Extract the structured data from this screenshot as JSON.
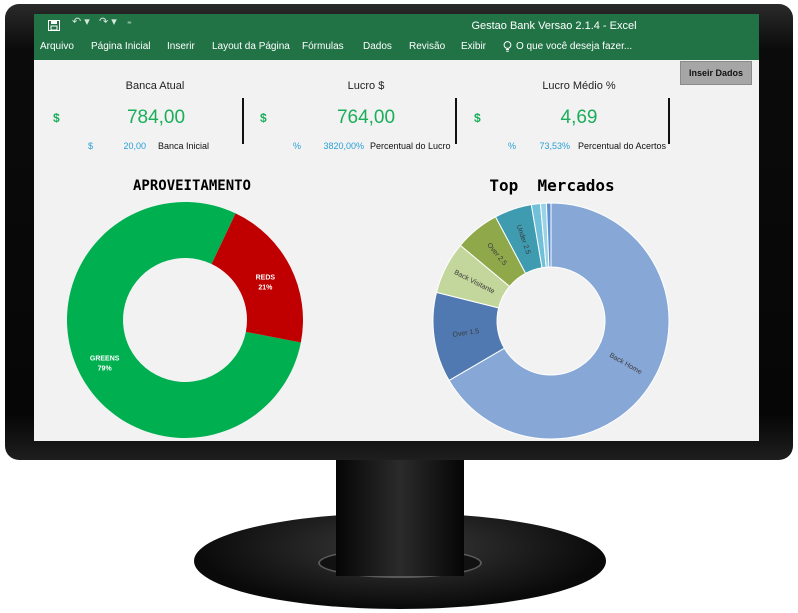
{
  "window": {
    "title": "Gestao Bank Versao 2.1.4 - Excel",
    "quick_access": [
      "save-icon",
      "undo-icon",
      "redo-icon",
      "customize-icon"
    ]
  },
  "ribbon": {
    "tabs": [
      "Arquivo",
      "Página Inicial",
      "Inserir",
      "Layout da Página",
      "Fórmulas",
      "Dados",
      "Revisão",
      "Exibir"
    ],
    "tell_me": "O que você deseja fazer...",
    "tell_me_icon": "lightbulb-icon",
    "accent_color": "#217346"
  },
  "dashboard": {
    "button_label": "Inseir Dados",
    "kpis": [
      {
        "title": "Banca Atual",
        "currency": "$",
        "value": "784,00",
        "sub_symbol": "$",
        "sub_value": "20,00",
        "sub_label": "Banca Inicial"
      },
      {
        "title": "Lucro $",
        "currency": "$",
        "value": "764,00",
        "sub_symbol": "%",
        "sub_value": "3820,00%",
        "sub_label": "Percentual do Lucro"
      },
      {
        "title": "Lucro Médio %",
        "currency": "$",
        "value": "4,69",
        "sub_symbol": "%",
        "sub_value": "73,53%",
        "sub_label": "Percentual do Acertos"
      }
    ]
  },
  "chart_data": [
    {
      "type": "pie",
      "title": "APROVEITAMENTO",
      "donut": true,
      "slices": [
        {
          "label": "GREENS",
          "value": 79,
          "display": "79%",
          "color": "#00b050"
        },
        {
          "label": "REDS",
          "value": 21,
          "display": "21%",
          "color": "#c00000"
        }
      ]
    },
    {
      "type": "pie",
      "title": "Top  Mercados",
      "donut": true,
      "slices": [
        {
          "label": "Back Home",
          "value": 65,
          "color": "#87a8d6"
        },
        {
          "label": "Over 1.5",
          "value": 12,
          "color": "#4f79b0"
        },
        {
          "label": "Back Visitante",
          "value": 7,
          "color": "#c3d69b"
        },
        {
          "label": "Over 2.5",
          "value": 6,
          "color": "#8fa84a"
        },
        {
          "label": "Under 2.5",
          "value": 5,
          "color": "#3e9bb0"
        },
        {
          "label": "",
          "value": 1.2,
          "color": "#6fc0d8"
        },
        {
          "label": "",
          "value": 0.8,
          "color": "#9bd3e6"
        },
        {
          "label": "",
          "value": 0.6,
          "color": "#5b8fd0"
        }
      ]
    }
  ]
}
